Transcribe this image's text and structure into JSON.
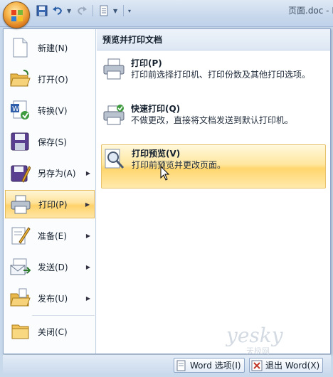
{
  "window": {
    "title": "页面.doc - M"
  },
  "quick_access": {
    "icons": [
      "save-icon",
      "undo-icon",
      "redo-icon",
      "format-icon",
      "customize-icon"
    ]
  },
  "menu": {
    "left_items": [
      {
        "label": "新建(N)",
        "icon": "new-document-icon",
        "has_arrow": false
      },
      {
        "label": "打开(O)",
        "icon": "open-folder-icon",
        "has_arrow": false
      },
      {
        "label": "转换(V)",
        "icon": "convert-icon",
        "has_arrow": false
      },
      {
        "label": "保存(S)",
        "icon": "save-disk-icon",
        "has_arrow": false
      },
      {
        "label": "另存为(A)",
        "icon": "save-as-icon",
        "has_arrow": true
      },
      {
        "label": "打印(P)",
        "icon": "printer-icon",
        "has_arrow": true,
        "active": true
      },
      {
        "label": "准备(E)",
        "icon": "prepare-icon",
        "has_arrow": true
      },
      {
        "label": "发送(D)",
        "icon": "send-icon",
        "has_arrow": true
      },
      {
        "label": "发布(U)",
        "icon": "publish-icon",
        "has_arrow": true
      },
      {
        "label": "关闭(C)",
        "icon": "close-folder-icon",
        "has_arrow": false
      }
    ],
    "right_header": "预览并打印文档",
    "right_items": [
      {
        "title": "打印(P)",
        "desc": "打印前选择打印机、打印份数及其他打印选项。",
        "icon": "printer-icon"
      },
      {
        "title": "快速打印(Q)",
        "desc": "不做更改，直接将文档发送到默认打印机。",
        "icon": "quick-print-icon"
      },
      {
        "title": "打印预览(V)",
        "desc": "打印前预览并更改页面。",
        "icon": "print-preview-icon",
        "hover": true
      }
    ]
  },
  "bottom_bar": {
    "options_label": "Word 选项(I)",
    "exit_label": "退出 Word(X)"
  },
  "watermark": {
    "line1": "yesky",
    "line2": "天极网"
  },
  "colors": {
    "accent": "#ffd66e",
    "border": "#8ea7c9"
  }
}
